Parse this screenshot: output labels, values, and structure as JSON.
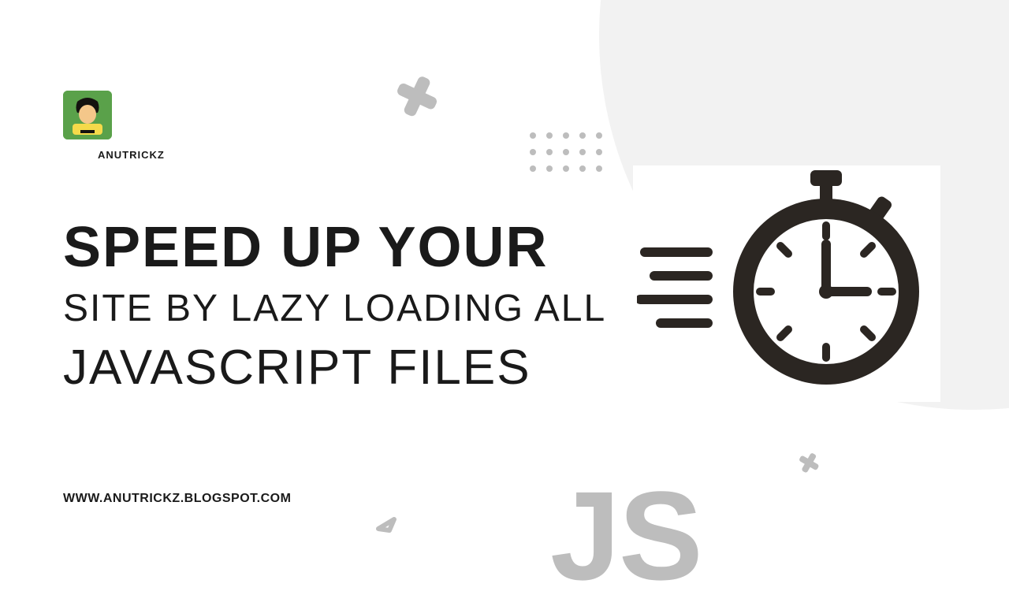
{
  "author": {
    "name": "ANUTRICKZ"
  },
  "headline": {
    "line1": "SPEED UP YOUR",
    "line2": "SITE BY LAZY LOADING ALL",
    "line3": "JAVASCRIPT FILES"
  },
  "site_url": "WWW.ANUTRICKZ.BLOGSPOT.COM",
  "hero": {
    "js_label": "JS"
  },
  "colors": {
    "bg_accent": "#f2f2f2",
    "text": "#1a1a1a",
    "decoration": "#bdbdbd",
    "stopwatch": "#2b2622",
    "avatar_bg": "#5aa14a"
  }
}
